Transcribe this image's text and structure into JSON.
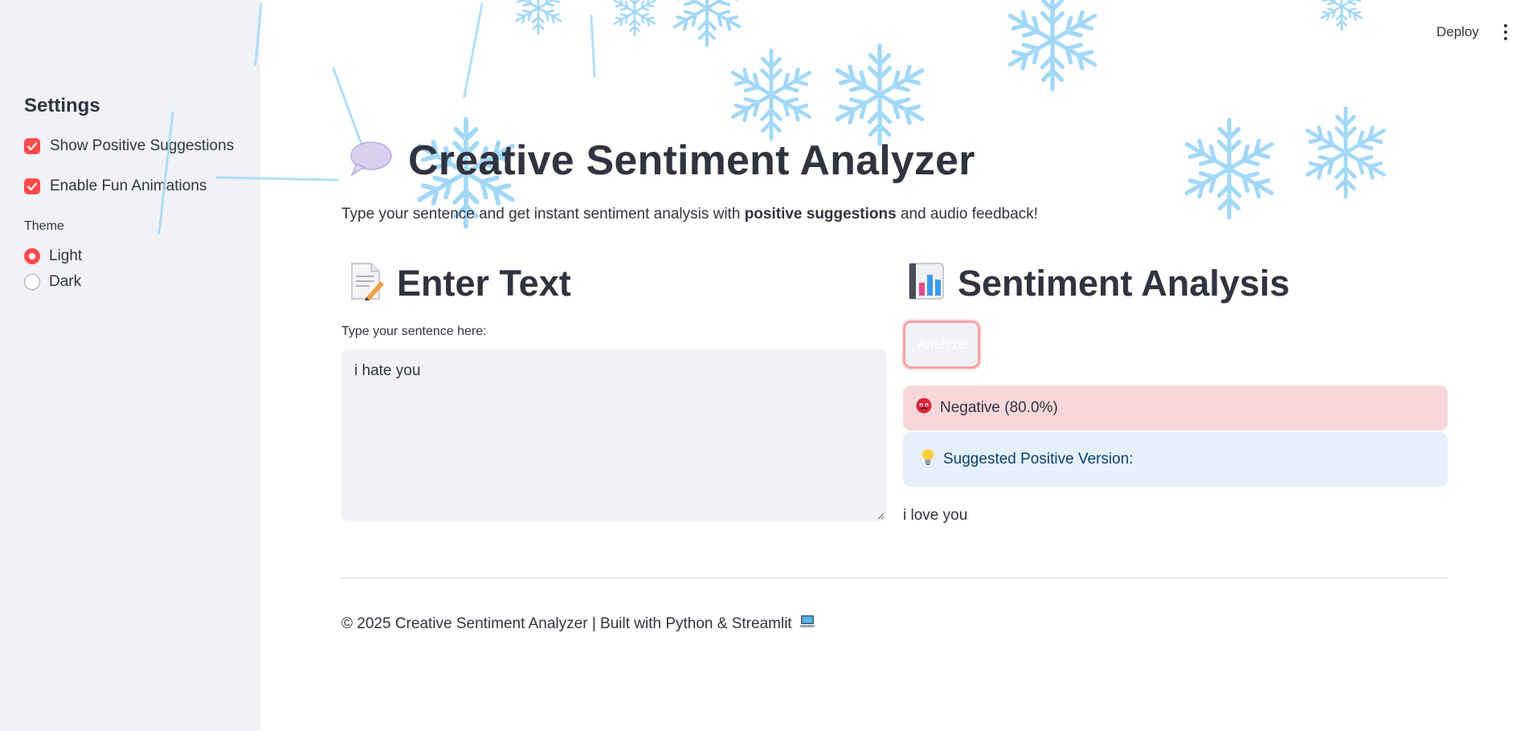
{
  "sidebar": {
    "title": "Settings",
    "checkboxes": [
      {
        "label": "Show Positive Suggestions",
        "checked": true
      },
      {
        "label": "Enable Fun Animations",
        "checked": true
      }
    ],
    "theme": {
      "label": "Theme",
      "options": [
        "Light",
        "Dark"
      ],
      "selected": "Light"
    }
  },
  "header": {
    "deploy_label": "Deploy",
    "menu_icon": "kebab-menu-icon"
  },
  "main": {
    "title": "Creative Sentiment Analyzer",
    "title_icon": "speech-balloon-icon",
    "subtitle_pre": "Type your sentence and get instant sentiment analysis with ",
    "subtitle_bold": "positive suggestions",
    "subtitle_post": " and audio feedback!",
    "left": {
      "heading": "Enter Text",
      "heading_icon": "memo-icon",
      "input_label": "Type your sentence here:",
      "input_value": "i hate you"
    },
    "right": {
      "heading": "Sentiment Analysis",
      "heading_icon": "bar-chart-icon",
      "analyze_label": "Analyze",
      "result_text": "Negative (80.0%)",
      "result_icon": "angry-face-icon",
      "suggestion_heading": "Suggested Positive Version:",
      "suggestion_icon": "light-bulb-icon",
      "suggestion_text": "i love you"
    },
    "footer_text": "© 2025 Creative Sentiment Analyzer | Built with Python & Streamlit",
    "footer_icon": "laptop-icon"
  },
  "colors": {
    "accent": "#ff4b4b",
    "sidebar_bg": "#f0f2f6",
    "negative_bg": "#f8d7da",
    "info_bg": "#e6f0fb",
    "snow": "#9fd6f7"
  }
}
